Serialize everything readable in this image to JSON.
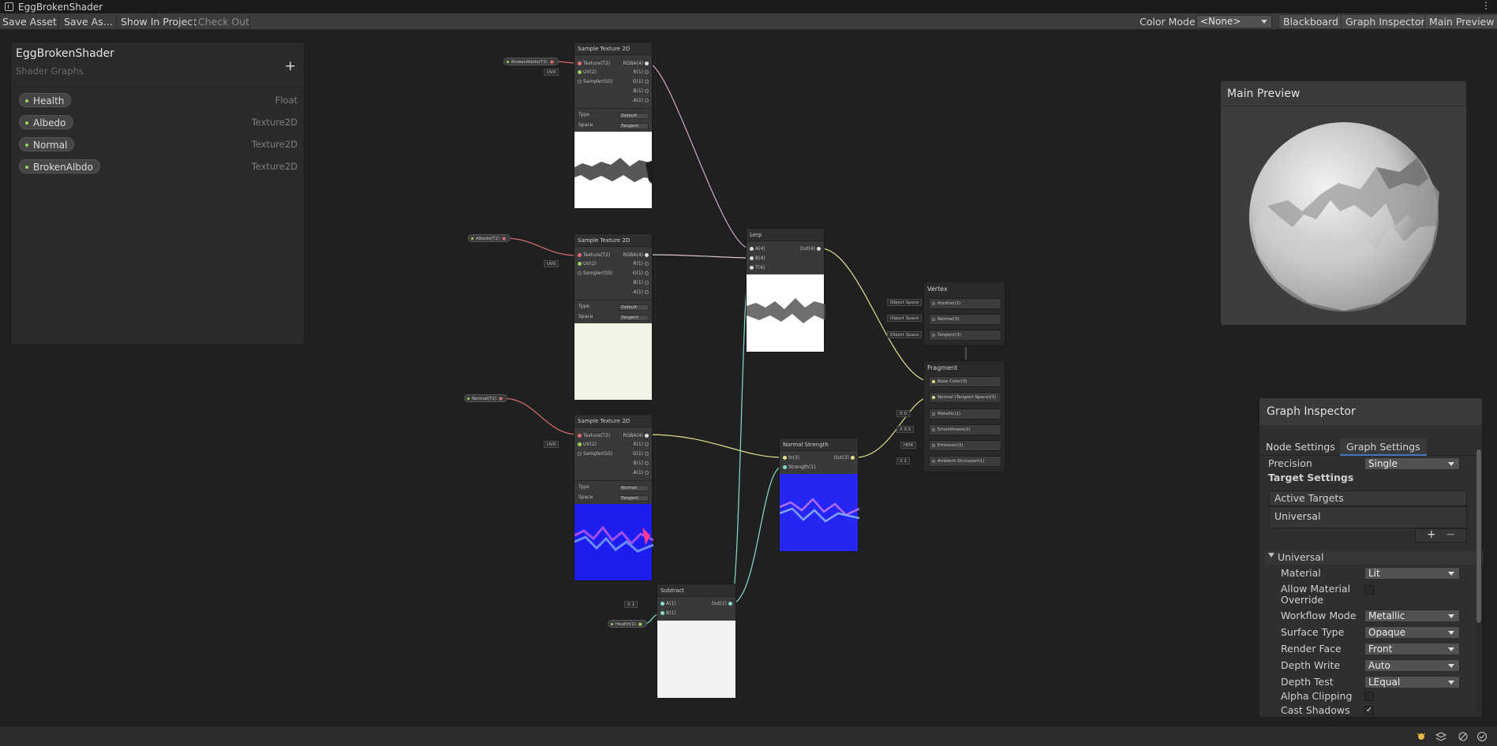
{
  "window": {
    "title": "EggBrokenShader"
  },
  "toolbar": {
    "save_asset": "Save Asset",
    "save_as": "Save As...",
    "show_in_project": "Show In Project",
    "check_out": "Check Out",
    "color_mode_label": "Color Mode",
    "color_mode_value": "<None>",
    "blackboard": "Blackboard",
    "graph_inspector": "Graph Inspector",
    "main_preview": "Main Preview"
  },
  "blackboard": {
    "title": "EggBrokenShader",
    "subtitle": "Shader Graphs",
    "add_icon": "plus-icon",
    "properties": [
      {
        "name": "Health",
        "type": "Float"
      },
      {
        "name": "Albedo",
        "type": "Texture2D"
      },
      {
        "name": "Normal",
        "type": "Texture2D"
      },
      {
        "name": "BrokenAlbdo",
        "type": "Texture2D"
      }
    ]
  },
  "graph": {
    "chips": {
      "broken": "BrokenAlbdo(T2)",
      "albedo": "Albedo(T2)",
      "normal": "Normal(T2)",
      "health": "Health(1)"
    },
    "sample_texture": {
      "title": "Sample Texture 2D",
      "in_texture": "Texture(T2)",
      "in_uv": "UV(2)",
      "in_sampler": "Sampler(SS)",
      "out_rgba": "RGBA(4)",
      "out_r": "R(1)",
      "out_g": "G(1)",
      "out_b": "B(1)",
      "out_a": "A(1)",
      "type_label": "Type",
      "space_label": "Space",
      "space_value": "Tangent",
      "uv_field": "UV0",
      "type_values": [
        "Default",
        "Default",
        "Normal"
      ]
    },
    "lerp": {
      "title": "Lerp",
      "in_a": "A(4)",
      "in_b": "B(4)",
      "in_t": "T(4)",
      "out": "Out(4)"
    },
    "normal_strength": {
      "title": "Normal Strength",
      "in": "In(3)",
      "strength": "Strength(1)",
      "out": "Out(3)"
    },
    "subtract": {
      "title": "Subtract",
      "in_a": "A(1)",
      "in_b": "B(1)",
      "out": "Out(1)",
      "a_field_x": "X",
      "a_field_val": "1"
    },
    "vertex": {
      "title": "Vertex",
      "blocks": [
        "Position(3)",
        "Normal(3)",
        "Tangent(3)"
      ],
      "space": "Object Space"
    },
    "fragment": {
      "title": "Fragment",
      "blocks": [
        "Base Color(3)",
        "Normal (Tangent Space)(3)",
        "Metallic(1)",
        "Smoothness(1)",
        "Emission(3)",
        "Ambient Occlusion(1)"
      ],
      "fields": [
        {
          "x": "X",
          "val": "0"
        },
        {
          "x": "X",
          "val": "0.5"
        },
        {
          "x": "",
          "val": "HDR"
        },
        {
          "x": "X",
          "val": "1"
        }
      ]
    }
  },
  "main_preview": {
    "title": "Main Preview"
  },
  "inspector": {
    "title": "Graph Inspector",
    "tabs": [
      "Node Settings",
      "Graph Settings"
    ],
    "precision_label": "Precision",
    "precision_value": "Single",
    "target_settings": "Target Settings",
    "active_targets": "Active Targets",
    "target_item": "Universal",
    "universal_header": "Universal",
    "rows": [
      {
        "label": "Material",
        "value": "Lit"
      },
      {
        "label": "Allow Material Override",
        "value": ""
      },
      {
        "label": "Workflow Mode",
        "value": "Metallic"
      },
      {
        "label": "Surface Type",
        "value": "Opaque"
      },
      {
        "label": "Render Face",
        "value": "Front"
      },
      {
        "label": "Depth Write",
        "value": "Auto"
      },
      {
        "label": "Depth Test",
        "value": "LEqual"
      },
      {
        "label": "Alpha Clipping",
        "value": ""
      },
      {
        "label": "Cast Shadows",
        "value": "✓"
      }
    ]
  },
  "colors": {
    "accent": "#3c79c4",
    "texture_wire": "#d4a8c8",
    "vector4_wire": "#d8c4d6",
    "vector3_wire": "#e2e08a",
    "float_wire": "#86e0d0",
    "property_wire": "#d46a6a"
  }
}
